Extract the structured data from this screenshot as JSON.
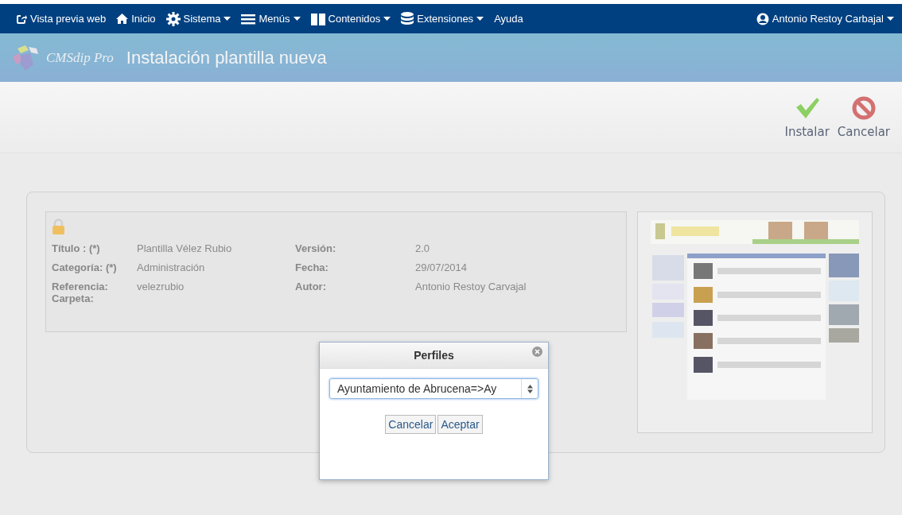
{
  "navbar": {
    "items": [
      {
        "label": "Vista previa web",
        "dropdown": false
      },
      {
        "label": "Inicio",
        "dropdown": false
      },
      {
        "label": "Sistema",
        "dropdown": true
      },
      {
        "label": "Menús",
        "dropdown": true
      },
      {
        "label": "Contenidos",
        "dropdown": true
      },
      {
        "label": "Extensiones",
        "dropdown": true
      },
      {
        "label": "Ayuda",
        "dropdown": false
      }
    ],
    "user": {
      "label": "Antonio Restoy Carbajal",
      "dropdown": true
    }
  },
  "header": {
    "logo": "CMSdip Pro",
    "title": "Instalación plantilla nueva"
  },
  "toolbar": {
    "buttons": [
      {
        "label": "Instalar",
        "kind": "confirm"
      },
      {
        "label": "Cancelar",
        "kind": "cancel"
      }
    ]
  },
  "template": {
    "rows": [
      {
        "left": {
          "label": "Título : (*)",
          "value": "Plantilla Vélez Rubio"
        },
        "right": {
          "label": "Versión:",
          "value": "2.0"
        }
      },
      {
        "left": {
          "label": "Categoría: (*)",
          "value": "Administración"
        },
        "right": {
          "label": "Fecha:",
          "value": "29/07/2014"
        }
      },
      {
        "left": {
          "label": "Referencia: Carpeta:",
          "value": "velezrubio"
        },
        "right": {
          "label": "Autor:",
          "value": "Antonio Restoy Carvajal"
        }
      }
    ]
  },
  "dialog": {
    "title": "Perfiles",
    "select_value": "Ayuntamiento de Abrucena=>Ay",
    "buttons": [
      "Cancelar",
      "Aceptar"
    ]
  }
}
